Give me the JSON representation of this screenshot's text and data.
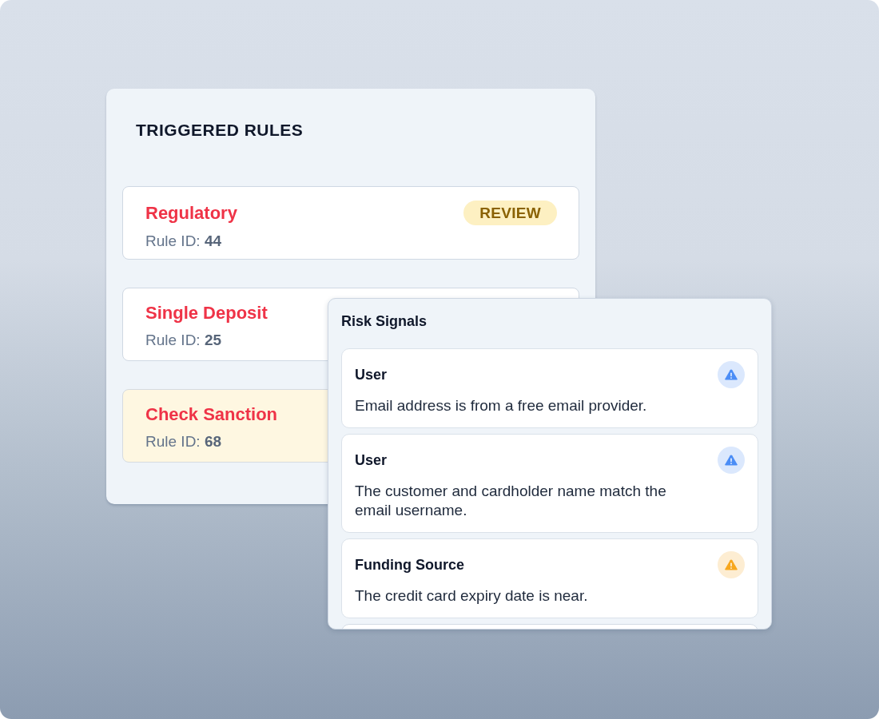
{
  "triggered_rules": {
    "title": "TRIGGERED RULES",
    "rules": [
      {
        "name": "Regulatory",
        "rule_id": "Rule ID: **44**",
        "badge": "REVIEW",
        "selected": false
      },
      {
        "name": "Single Deposit",
        "rule_id": "Rule ID: **25**",
        "selected": false
      },
      {
        "name": "Check Sanction",
        "rule_id": "Rule ID: **68**",
        "selected": true
      }
    ]
  },
  "risk_signals": {
    "title": "Risk Signals",
    "signals": [
      {
        "category": "User",
        "description": "Email address is from a free email provider.",
        "color": "#4b8df6"
      },
      {
        "category": "User",
        "description": "The customer and cardholder name match the email username.",
        "color": "#4b8df6"
      },
      {
        "category": "Funding Source",
        "description": "The credit card expiry date is near.",
        "color": "#f7a71d"
      }
    ],
    "more_below": true
  }
}
